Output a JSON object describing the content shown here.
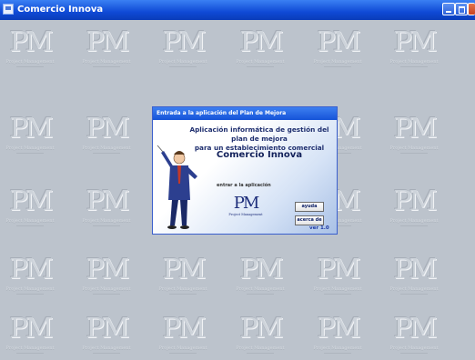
{
  "window": {
    "title": "Comercio Innova"
  },
  "background": {
    "logo_text": "PM",
    "logo_subtext": "Project Management"
  },
  "dialog": {
    "title": "Entrada a la aplicación del Plan de Mejora",
    "subtitle_line1": "Aplicación informática de gestión del plan de mejora",
    "subtitle_line2": "para un establecimiento comercial",
    "app_name": "Comercio Innova",
    "enter_label": "entrar a la aplicación",
    "logo_text": "PM",
    "logo_subtext": "Project Management",
    "help_button": "ayuda",
    "about_button": "acerca de",
    "version": "ver 1.0"
  },
  "colors": {
    "titlebar": "#0f4ad6",
    "desktop": "#bcc3cc",
    "dialog_accent": "#1d2d7a"
  }
}
